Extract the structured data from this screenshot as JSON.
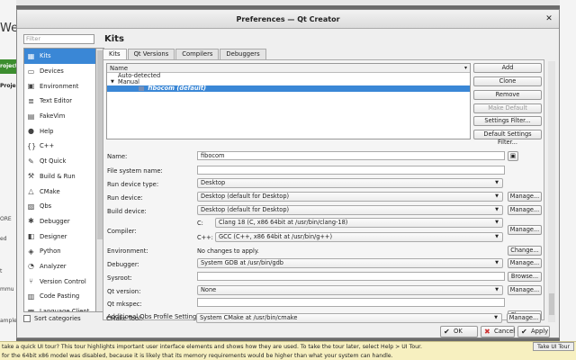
{
  "background": {
    "welcome_fragment": "Welc",
    "projects_fragment": "roject",
    "projects_heading": "Project",
    "left_texts": [
      "ORE",
      "ed",
      "t",
      "mmu",
      "ample"
    ],
    "tour_text": "take a quick UI tour? This tour highlights important user interface elements and shows how they are used. To take the tour later, select Help > UI Tour.",
    "tour_button": "Take UI Tour",
    "info_text": "for the 64bit x86 model was disabled, because it is likely that its memory requirements would be higher than what your system can handle."
  },
  "dialog": {
    "title": "Preferences — Qt Creator",
    "close_glyph": "✕",
    "filter_placeholder": "Filter",
    "categories": [
      {
        "label": "Kits",
        "icon": "kits-icon",
        "glyph": "▦"
      },
      {
        "label": "Devices",
        "icon": "devices-icon",
        "glyph": "▭"
      },
      {
        "label": "Environment",
        "icon": "environment-icon",
        "glyph": "▣"
      },
      {
        "label": "Text Editor",
        "icon": "text-editor-icon",
        "glyph": "≣"
      },
      {
        "label": "FakeVim",
        "icon": "fakevim-icon",
        "glyph": "▤"
      },
      {
        "label": "Help",
        "icon": "help-icon",
        "glyph": "●"
      },
      {
        "label": "C++",
        "icon": "cpp-icon",
        "glyph": "{}"
      },
      {
        "label": "Qt Quick",
        "icon": "qt-quick-icon",
        "glyph": "✎"
      },
      {
        "label": "Build & Run",
        "icon": "build-run-icon",
        "glyph": "⚒"
      },
      {
        "label": "CMake",
        "icon": "cmake-icon",
        "glyph": "△"
      },
      {
        "label": "Qbs",
        "icon": "qbs-icon",
        "glyph": "▧"
      },
      {
        "label": "Debugger",
        "icon": "debugger-icon",
        "glyph": "✱"
      },
      {
        "label": "Designer",
        "icon": "designer-icon",
        "glyph": "◧"
      },
      {
        "label": "Python",
        "icon": "python-icon",
        "glyph": "◈"
      },
      {
        "label": "Analyzer",
        "icon": "analyzer-icon",
        "glyph": "◔"
      },
      {
        "label": "Version Control",
        "icon": "version-control-icon",
        "glyph": "⑂"
      },
      {
        "label": "Code Pasting",
        "icon": "code-pasting-icon",
        "glyph": "▥"
      },
      {
        "label": "Language Client",
        "icon": "language-client-icon",
        "glyph": "▩"
      }
    ],
    "sort_categories": "Sort categories",
    "page_title": "Kits",
    "tabs": [
      "Kits",
      "Qt Versions",
      "Compilers",
      "Debuggers"
    ],
    "tree": {
      "header": "Name",
      "rows": [
        "Auto-detected",
        "Manual",
        "fibocom (default)"
      ]
    },
    "side_buttons": [
      "Add",
      "Clone",
      "Remove",
      "Make Default",
      "Settings Filter...",
      "Default Settings Filter..."
    ],
    "form": {
      "name_label": "Name:",
      "name_value": "fibocom",
      "fs_label": "File system name:",
      "fs_value": "",
      "run_type_label": "Run device type:",
      "run_type_value": "Desktop",
      "run_device_label": "Run device:",
      "run_device_value": "Desktop (default for Desktop)",
      "build_device_label": "Build device:",
      "build_device_value": "Desktop (default for Desktop)",
      "compiler_label": "Compiler:",
      "c_label": "C:",
      "c_value": "Clang 18 (C, x86 64bit at /usr/bin/clang-18)",
      "cpp_label": "C++:",
      "cpp_value": "GCC (C++, x86 64bit at /usr/bin/g++)",
      "env_label": "Environment:",
      "env_value": "No changes to apply.",
      "debugger_label": "Debugger:",
      "debugger_value": "System GDB at /usr/bin/gdb",
      "sysroot_label": "Sysroot:",
      "sysroot_value": "",
      "qt_label": "Qt version:",
      "qt_value": "None",
      "mkspec_label": "Qt mkspec:",
      "mkspec_value": "",
      "qbs_label": "Additional Qbs Profile Settings:",
      "cmake_label": "CMake Tool:",
      "cmake_value": "System CMake at /usr/bin/cmake",
      "manage": "Manage...",
      "change": "Change...",
      "browse": "Browse..."
    },
    "footer": {
      "ok": "OK",
      "cancel": "Cancel",
      "apply": "Apply"
    }
  }
}
